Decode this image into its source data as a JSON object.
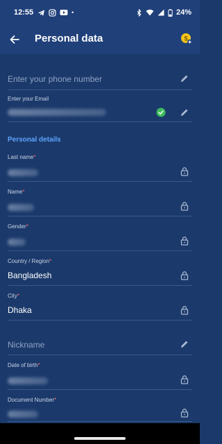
{
  "status": {
    "time": "12:55",
    "dot": "•",
    "battery": "24%"
  },
  "appbar": {
    "title": "Personal data"
  },
  "contact": {
    "phone_placeholder": "Enter your phone number",
    "email_label": "Enter your Email"
  },
  "section": {
    "title": "Personal details"
  },
  "fields": {
    "last_name": {
      "label": "Last name",
      "req": "*"
    },
    "name": {
      "label": "Name",
      "req": "*"
    },
    "gender": {
      "label": "Gender",
      "req": "*"
    },
    "country": {
      "label": "Country / Region",
      "req": "*",
      "value": "Bangladesh"
    },
    "city": {
      "label": "City",
      "req": "*",
      "value": "Dhaka"
    },
    "nickname": {
      "placeholder": "Nickname"
    },
    "dob": {
      "label": "Date of birth",
      "req": "*"
    },
    "document": {
      "label": "Document Number",
      "req": "*"
    }
  },
  "colors": {
    "background": "#1b3a6b",
    "bar": "#20407a",
    "accent": "#5ea3ff",
    "required": "#ff6b6b",
    "verified": "#3dbb5b",
    "coin": "#f5c518"
  },
  "icons": {
    "back": "arrow-left-icon",
    "coin": "coin-add-icon",
    "edit": "pencil-icon",
    "lock": "lock-icon",
    "verified": "check-circle-icon"
  }
}
